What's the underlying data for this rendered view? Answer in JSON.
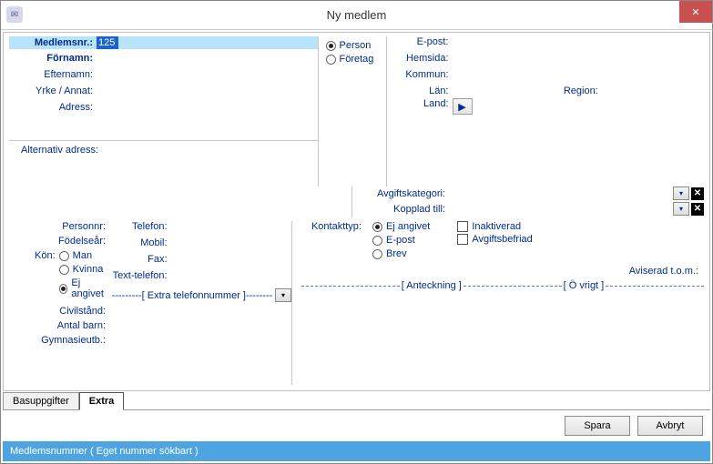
{
  "window": {
    "title": "Ny medlem",
    "close_label": "✕"
  },
  "left": {
    "member_no_label": "Medlemsnr.:",
    "member_no_value": "125",
    "firstname_label": "Förnamn:",
    "lastname_label": "Efternamn:",
    "occupation_label": "Yrke / Annat:",
    "address_label": "Adress:",
    "alt_address_label": "Alternativ adress:"
  },
  "type": {
    "option_person": "Person",
    "option_company": "Företag",
    "selected": "person"
  },
  "right": {
    "email_label": "E-post:",
    "website_label": "Hemsida:",
    "municipality_label": "Kommun:",
    "county_label": "Län:",
    "region_label": "Region:",
    "country_label": "Land:"
  },
  "fee": {
    "category_label": "Avgiftskategori:",
    "linked_label": "Kopplad till:"
  },
  "person": {
    "personnr_label": "Personnr:",
    "birthyear_label": "Födelseår:",
    "gender_label": "Kön:",
    "gender_man": "Man",
    "gender_woman": "Kvinna",
    "gender_na": "Ej angivet",
    "civil_label": "Civilstånd:",
    "children_label": "Antal barn:",
    "education_label": "Gymnasieutb.:"
  },
  "tel": {
    "phone_label": "Telefon:",
    "mobile_label": "Mobil:",
    "fax_label": "Fax:",
    "text_label": "Text-telefon:",
    "extra_header": "---------[ Extra telefonnummer ]--------"
  },
  "contact": {
    "label": "Kontakttyp:",
    "opt_na": "Ej angivet",
    "opt_email": "E-post",
    "opt_letter": "Brev",
    "chk_inactive": "Inaktiverad",
    "chk_feefree": "Avgiftsbefriad",
    "notified_label": "Aviserad t.o.m.:"
  },
  "sections": {
    "note": "[ Anteckning ]",
    "other": "[ Ö vrigt ]"
  },
  "tabs": {
    "basic": "Basuppgifter",
    "extra": "Extra"
  },
  "buttons": {
    "save": "Spara",
    "cancel": "Avbryt"
  },
  "status": "Medlemsnummer ( Eget nummer sökbart )"
}
